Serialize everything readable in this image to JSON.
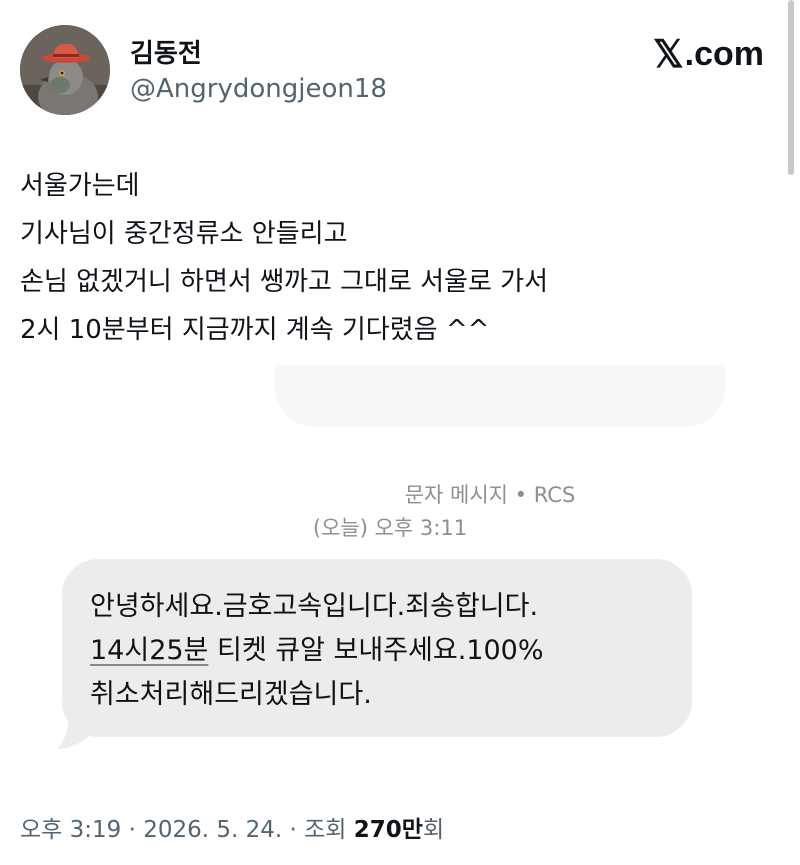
{
  "author": {
    "display_name": "김동전",
    "handle": "@Angrydongjeon18"
  },
  "brand": {
    "x": "𝕏",
    "domain": ".com"
  },
  "tweet": {
    "lines": [
      "서울가는데",
      "기사님이 중간정류소 안들리고",
      "손님 없겠거니 하면서 쌩까고 그대로 서울로 가서",
      "2시 10분부터 지금까지 계속 기다렸음 ^^"
    ]
  },
  "embed": {
    "meta_line1": "문자 메시지 • RCS",
    "meta_line2": "(오늘) 오후 3:11",
    "message": {
      "line1": "안녕하세요.금호고속입니다.죄송합니다.",
      "line2_link": "14시25분",
      "line2_rest": " 티켓 큐알 보내주세요.100%",
      "line3": "취소처리해드리겠습니다."
    }
  },
  "footer": {
    "time_date": "오후 3:19 · 2026. 5. 24. · 조회 ",
    "views_count": "270만",
    "views_suffix": "회"
  },
  "colors": {
    "text": "#0f1419",
    "secondary": "#536471",
    "bubble": "#ececee",
    "meta": "#8e8e93"
  }
}
